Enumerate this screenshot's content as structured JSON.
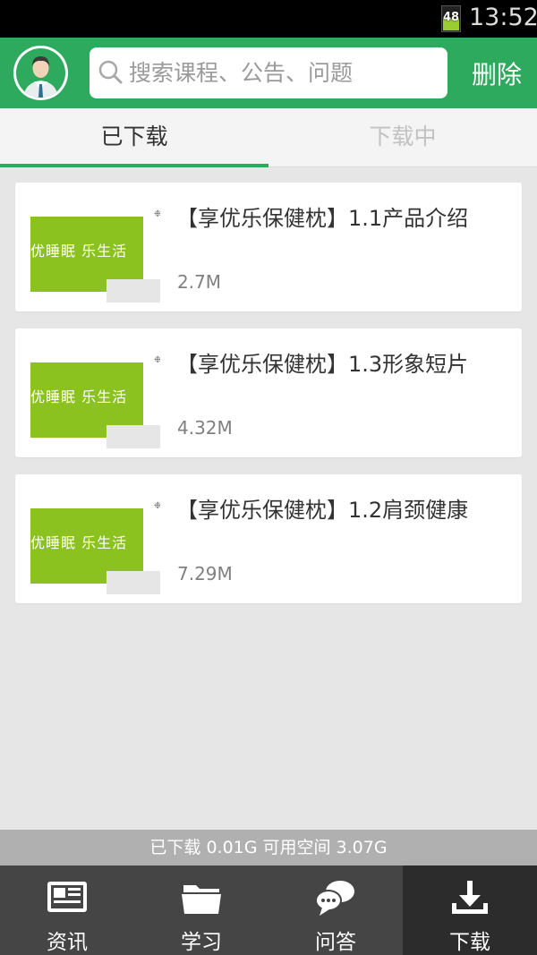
{
  "status_bar": {
    "battery_level": "48",
    "time": "13:52"
  },
  "header": {
    "search_placeholder": "搜索课程、公告、问题",
    "delete_label": "删除"
  },
  "tabs": [
    {
      "label": "已下载",
      "active": true
    },
    {
      "label": "下载中",
      "active": false
    }
  ],
  "downloads": [
    {
      "title": "【享优乐保健枕】1.1产品介绍",
      "size": "2.7M",
      "thumb_text": "优睡眠   乐生活"
    },
    {
      "title": "【享优乐保健枕】1.3形象短片",
      "size": "4.32M",
      "thumb_text": "优睡眠   乐生活"
    },
    {
      "title": "【享优乐保健枕】1.2肩颈健康",
      "size": "7.29M",
      "thumb_text": "优睡眠   乐生活"
    }
  ],
  "storage": {
    "text": "已下载 0.01G  可用空间 3.07G"
  },
  "bottom_nav": [
    {
      "label": "资讯",
      "icon": "newspaper-icon"
    },
    {
      "label": "学习",
      "icon": "folder-icon"
    },
    {
      "label": "问答",
      "icon": "chat-bubbles-icon"
    },
    {
      "label": "下载",
      "icon": "download-icon",
      "active": true
    }
  ],
  "colors": {
    "brand": "#2eaa5e",
    "thumb_green": "#8cc220",
    "nav_bg": "#454545"
  }
}
